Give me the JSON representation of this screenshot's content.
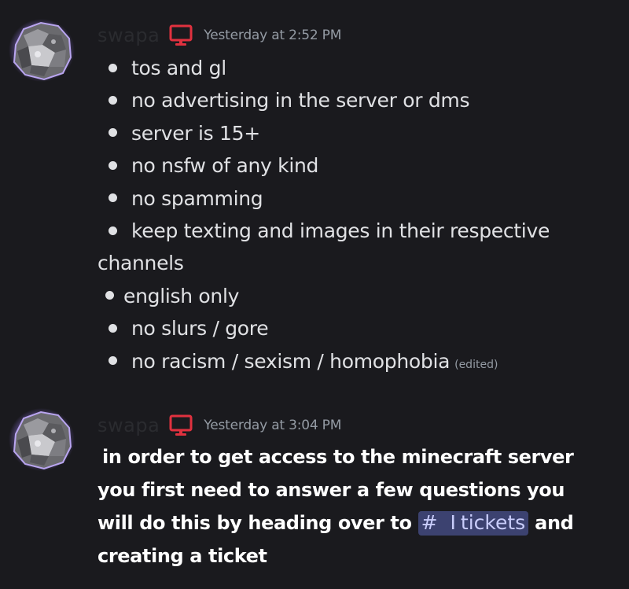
{
  "messages": [
    {
      "username": "swapa",
      "timestamp": "Yesterday at 2:52 PM",
      "rules": [
        "tos and gl",
        "no advertising in the server or dms",
        "server is 15+",
        "no nsfw of any kind",
        "no spamming",
        "keep texting and images in their respective",
        "channels",
        "english only",
        "no slurs / gore",
        "no racism / sexism / homophobia"
      ],
      "edited_label": "(edited)"
    },
    {
      "username": "swapa",
      "timestamp": "Yesterday at 3:04 PM",
      "lines": [
        "in order to get access to the minecraft server",
        "you first need to answer a few questions you",
        "will do this by heading over to",
        "creating a ticket"
      ],
      "channel_mention": {
        "hash": "#",
        "pipe": "I",
        "name": "tickets"
      },
      "after_mention": " and"
    }
  ],
  "colors": {
    "background": "#1a1a1e",
    "text": "#dbdee1",
    "timestamp": "#949ba4",
    "monitor_icon": "#e0313f",
    "mention_bg": "#3c4270",
    "mention_text": "#c9cdfb"
  },
  "icons": [
    "avatar-rock",
    "monitor-icon"
  ]
}
